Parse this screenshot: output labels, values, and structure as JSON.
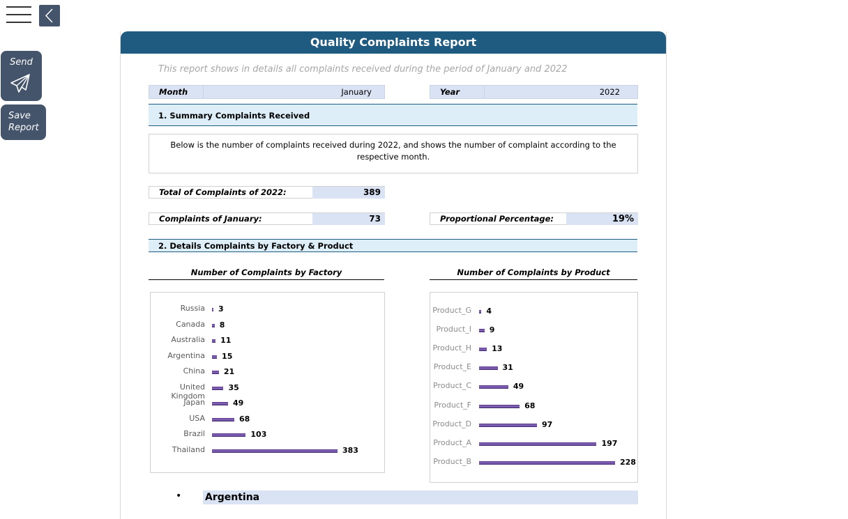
{
  "nav": {
    "send_label": "Send",
    "save_label_line1": "Save",
    "save_label_line2": "Report"
  },
  "report": {
    "title": "Quality Complaints Report",
    "subtitle": "This report shows in details all complaints received during the period of January and 2022",
    "month_label": "Month",
    "month_value": "January",
    "year_label": "Year",
    "year_value": "2022",
    "section1_title": "1. Summary Complaints Received",
    "section1_desc": "Below is the number of complaints received during 2022, and shows the number of complaint according to the respective month.",
    "total_label": "Total of Complaints of 2022:",
    "total_value": "389",
    "month_complaints_label": "Complaints of January:",
    "month_complaints_value": "73",
    "proportional_label": "Proportional Percentage:",
    "proportional_value": "19%",
    "section2_title": "2. Details Complaints by Factory & Product",
    "bullet": "•",
    "country_selected": "Argentina"
  },
  "colors": {
    "header": "#1f5b80",
    "field": "#dae3f3",
    "section": "#deeef8",
    "bar": "#6a4aa0"
  },
  "icons": [
    "hamburger-icon",
    "chevron-left-icon",
    "paper-plane-icon"
  ],
  "chart_data": [
    {
      "type": "bar",
      "orientation": "horizontal",
      "title": "Number of Complaints by Factory",
      "categories": [
        "Russia",
        "Canada",
        "Australia",
        "Argentina",
        "China",
        "United Kingdom",
        "Japan",
        "USA",
        "Brazil",
        "Thailand"
      ],
      "values": [
        3,
        8,
        11,
        15,
        21,
        35,
        49,
        68,
        103,
        383
      ],
      "xlim": [
        0,
        383
      ],
      "grid": false
    },
    {
      "type": "bar",
      "orientation": "horizontal",
      "title": "Number of Complaints by Product",
      "categories": [
        "Product_G",
        "Product_I",
        "Product_H",
        "Product_E",
        "Product_C",
        "Product_F",
        "Product_D",
        "Product_A",
        "Product_B"
      ],
      "values": [
        4,
        9,
        13,
        31,
        49,
        68,
        97,
        197,
        228
      ],
      "xlim": [
        0,
        228
      ],
      "grid": false
    }
  ]
}
